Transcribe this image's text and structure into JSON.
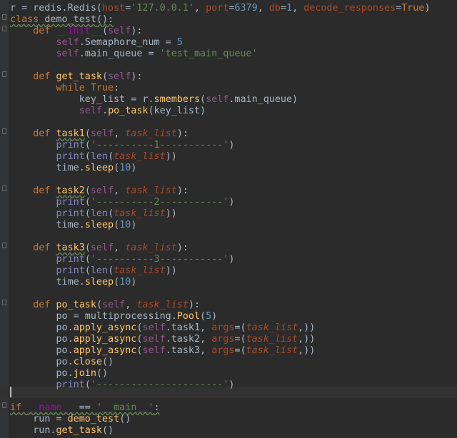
{
  "editor": {
    "lines": [
      [
        {
          "t": "r = redis.Redis(",
          "c": "plain"
        },
        {
          "t": "host",
          "c": "param"
        },
        {
          "t": "=",
          "c": "plain"
        },
        {
          "t": "'127.0.0.1'",
          "c": "str"
        },
        {
          "t": ", ",
          "c": "plain"
        },
        {
          "t": "port",
          "c": "param"
        },
        {
          "t": "=",
          "c": "plain"
        },
        {
          "t": "6379",
          "c": "num"
        },
        {
          "t": ", ",
          "c": "plain"
        },
        {
          "t": "db",
          "c": "param"
        },
        {
          "t": "=",
          "c": "plain"
        },
        {
          "t": "1",
          "c": "num"
        },
        {
          "t": ", ",
          "c": "plain"
        },
        {
          "t": "decode_responses",
          "c": "param"
        },
        {
          "t": "=",
          "c": "plain"
        },
        {
          "t": "True",
          "c": "kw"
        },
        {
          "t": ")",
          "c": "plain"
        }
      ],
      [
        {
          "t": "class ",
          "c": "kw-warn"
        },
        {
          "t": "demo_test",
          "c": "cls-warn"
        },
        {
          "t": "():",
          "c": "plain-warn"
        }
      ],
      [
        {
          "t": "    ",
          "c": "plain"
        },
        {
          "t": "def ",
          "c": "kw"
        },
        {
          "t": "__init__",
          "c": "dunder"
        },
        {
          "t": "(",
          "c": "plain"
        },
        {
          "t": "self",
          "c": "self"
        },
        {
          "t": "):",
          "c": "plain"
        }
      ],
      [
        {
          "t": "        ",
          "c": "plain"
        },
        {
          "t": "self",
          "c": "self"
        },
        {
          "t": ".Semaphore_num = ",
          "c": "plain"
        },
        {
          "t": "5",
          "c": "num"
        }
      ],
      [
        {
          "t": "        ",
          "c": "plain"
        },
        {
          "t": "self",
          "c": "self"
        },
        {
          "t": ".main_queue = ",
          "c": "plain"
        },
        {
          "t": "'test_main_queue'",
          "c": "str"
        }
      ],
      [],
      [
        {
          "t": "    ",
          "c": "plain"
        },
        {
          "t": "def ",
          "c": "kw"
        },
        {
          "t": "get_task",
          "c": "fn"
        },
        {
          "t": "(",
          "c": "plain"
        },
        {
          "t": "self",
          "c": "self"
        },
        {
          "t": "):",
          "c": "plain"
        }
      ],
      [
        {
          "t": "        ",
          "c": "plain"
        },
        {
          "t": "while ",
          "c": "kw"
        },
        {
          "t": "True",
          "c": "kw"
        },
        {
          "t": ":",
          "c": "plain"
        }
      ],
      [
        {
          "t": "            key_list = r.",
          "c": "plain"
        },
        {
          "t": "smembers",
          "c": "call"
        },
        {
          "t": "(",
          "c": "plain"
        },
        {
          "t": "self",
          "c": "self"
        },
        {
          "t": ".main_queue)",
          "c": "plain"
        }
      ],
      [
        {
          "t": "            ",
          "c": "plain"
        },
        {
          "t": "self",
          "c": "self"
        },
        {
          "t": ".",
          "c": "plain"
        },
        {
          "t": "po_task",
          "c": "call"
        },
        {
          "t": "(key_list)",
          "c": "plain"
        }
      ],
      [],
      [
        {
          "t": "    ",
          "c": "plain"
        },
        {
          "t": "def ",
          "c": "kw"
        },
        {
          "t": "task1",
          "c": "fn-warn"
        },
        {
          "t": "(",
          "c": "plain"
        },
        {
          "t": "self",
          "c": "self"
        },
        {
          "t": ", ",
          "c": "plain"
        },
        {
          "t": "task_list",
          "c": "pname"
        },
        {
          "t": "):",
          "c": "plain"
        }
      ],
      [
        {
          "t": "        ",
          "c": "plain"
        },
        {
          "t": "print",
          "c": "builtin"
        },
        {
          "t": "(",
          "c": "plain"
        },
        {
          "t": "'----------1-----------'",
          "c": "str"
        },
        {
          "t": ")",
          "c": "plain"
        }
      ],
      [
        {
          "t": "        ",
          "c": "plain"
        },
        {
          "t": "print",
          "c": "builtin"
        },
        {
          "t": "(",
          "c": "plain"
        },
        {
          "t": "len",
          "c": "builtin"
        },
        {
          "t": "(",
          "c": "plain"
        },
        {
          "t": "task_list",
          "c": "pname"
        },
        {
          "t": "))",
          "c": "plain"
        }
      ],
      [
        {
          "t": "        time.",
          "c": "plain"
        },
        {
          "t": "sleep",
          "c": "call"
        },
        {
          "t": "(",
          "c": "plain"
        },
        {
          "t": "10",
          "c": "num"
        },
        {
          "t": ")",
          "c": "plain"
        }
      ],
      [],
      [
        {
          "t": "    ",
          "c": "plain"
        },
        {
          "t": "def ",
          "c": "kw"
        },
        {
          "t": "task2",
          "c": "fn-warn"
        },
        {
          "t": "(",
          "c": "plain"
        },
        {
          "t": "self",
          "c": "self"
        },
        {
          "t": ", ",
          "c": "plain"
        },
        {
          "t": "task_list",
          "c": "pname"
        },
        {
          "t": "):",
          "c": "plain"
        }
      ],
      [
        {
          "t": "        ",
          "c": "plain"
        },
        {
          "t": "print",
          "c": "builtin"
        },
        {
          "t": "(",
          "c": "plain"
        },
        {
          "t": "'----------2-----------'",
          "c": "str"
        },
        {
          "t": ")",
          "c": "plain"
        }
      ],
      [
        {
          "t": "        ",
          "c": "plain"
        },
        {
          "t": "print",
          "c": "builtin"
        },
        {
          "t": "(",
          "c": "plain"
        },
        {
          "t": "len",
          "c": "builtin"
        },
        {
          "t": "(",
          "c": "plain"
        },
        {
          "t": "task_list",
          "c": "pname"
        },
        {
          "t": "))",
          "c": "plain"
        }
      ],
      [
        {
          "t": "        time.",
          "c": "plain"
        },
        {
          "t": "sleep",
          "c": "call"
        },
        {
          "t": "(",
          "c": "plain"
        },
        {
          "t": "10",
          "c": "num"
        },
        {
          "t": ")",
          "c": "plain"
        }
      ],
      [],
      [
        {
          "t": "    ",
          "c": "plain"
        },
        {
          "t": "def ",
          "c": "kw"
        },
        {
          "t": "task3",
          "c": "fn-warn"
        },
        {
          "t": "(",
          "c": "plain"
        },
        {
          "t": "self",
          "c": "self"
        },
        {
          "t": ", ",
          "c": "plain"
        },
        {
          "t": "task_list",
          "c": "pname"
        },
        {
          "t": "):",
          "c": "plain"
        }
      ],
      [
        {
          "t": "        ",
          "c": "plain"
        },
        {
          "t": "print",
          "c": "builtin"
        },
        {
          "t": "(",
          "c": "plain"
        },
        {
          "t": "'----------3-----------'",
          "c": "str"
        },
        {
          "t": ")",
          "c": "plain"
        }
      ],
      [
        {
          "t": "        ",
          "c": "plain"
        },
        {
          "t": "print",
          "c": "builtin"
        },
        {
          "t": "(",
          "c": "plain"
        },
        {
          "t": "len",
          "c": "builtin"
        },
        {
          "t": "(",
          "c": "plain"
        },
        {
          "t": "task_list",
          "c": "pname"
        },
        {
          "t": "))",
          "c": "plain"
        }
      ],
      [
        {
          "t": "        time.",
          "c": "plain"
        },
        {
          "t": "sleep",
          "c": "call"
        },
        {
          "t": "(",
          "c": "plain"
        },
        {
          "t": "10",
          "c": "num"
        },
        {
          "t": ")",
          "c": "plain"
        }
      ],
      [],
      [
        {
          "t": "    ",
          "c": "plain"
        },
        {
          "t": "def ",
          "c": "kw"
        },
        {
          "t": "po_task",
          "c": "fn"
        },
        {
          "t": "(",
          "c": "plain"
        },
        {
          "t": "self",
          "c": "self"
        },
        {
          "t": ", ",
          "c": "plain"
        },
        {
          "t": "task_list",
          "c": "pname"
        },
        {
          "t": "):",
          "c": "plain"
        }
      ],
      [
        {
          "t": "        po = multiprocessing.",
          "c": "plain"
        },
        {
          "t": "Pool",
          "c": "call"
        },
        {
          "t": "(",
          "c": "plain"
        },
        {
          "t": "5",
          "c": "num"
        },
        {
          "t": ")",
          "c": "plain"
        }
      ],
      [
        {
          "t": "        po.",
          "c": "plain"
        },
        {
          "t": "apply_async",
          "c": "call"
        },
        {
          "t": "(",
          "c": "plain"
        },
        {
          "t": "self",
          "c": "self"
        },
        {
          "t": ".task1, ",
          "c": "plain"
        },
        {
          "t": "args",
          "c": "param"
        },
        {
          "t": "=(",
          "c": "plain"
        },
        {
          "t": "task_list",
          "c": "pname"
        },
        {
          "t": ",))",
          "c": "plain"
        }
      ],
      [
        {
          "t": "        po.",
          "c": "plain"
        },
        {
          "t": "apply_async",
          "c": "call"
        },
        {
          "t": "(",
          "c": "plain"
        },
        {
          "t": "self",
          "c": "self"
        },
        {
          "t": ".task2, ",
          "c": "plain"
        },
        {
          "t": "args",
          "c": "param"
        },
        {
          "t": "=(",
          "c": "plain"
        },
        {
          "t": "task_list",
          "c": "pname"
        },
        {
          "t": ",))",
          "c": "plain"
        }
      ],
      [
        {
          "t": "        po.",
          "c": "plain"
        },
        {
          "t": "apply_async",
          "c": "call"
        },
        {
          "t": "(",
          "c": "plain"
        },
        {
          "t": "self",
          "c": "self"
        },
        {
          "t": ".task3, ",
          "c": "plain"
        },
        {
          "t": "args",
          "c": "param"
        },
        {
          "t": "=(",
          "c": "plain"
        },
        {
          "t": "task_list",
          "c": "pname"
        },
        {
          "t": ",))",
          "c": "plain"
        }
      ],
      [
        {
          "t": "        po.",
          "c": "plain"
        },
        {
          "t": "close",
          "c": "call"
        },
        {
          "t": "()",
          "c": "plain"
        }
      ],
      [
        {
          "t": "        po.",
          "c": "plain"
        },
        {
          "t": "join",
          "c": "call"
        },
        {
          "t": "()",
          "c": "plain"
        }
      ],
      [
        {
          "t": "        ",
          "c": "plain"
        },
        {
          "t": "print",
          "c": "builtin"
        },
        {
          "t": "(",
          "c": "plain"
        },
        {
          "t": "'----------------------'",
          "c": "str"
        },
        {
          "t": ")",
          "c": "plain"
        }
      ],
      [],
      [
        {
          "t": "if ",
          "c": "kw-warn"
        },
        {
          "t": "__name__",
          "c": "dunder-warn"
        },
        {
          "t": " == ",
          "c": "plain-warn"
        },
        {
          "t": "'__main__'",
          "c": "str-warn"
        },
        {
          "t": ":",
          "c": "plain-warn"
        }
      ],
      [
        {
          "t": "    run = ",
          "c": "plain"
        },
        {
          "t": "demo_test",
          "c": "call"
        },
        {
          "t": "()",
          "c": "plain"
        }
      ],
      [
        {
          "t": "    run.",
          "c": "plain"
        },
        {
          "t": "get_task",
          "c": "call"
        },
        {
          "t": "()",
          "c": "plain"
        }
      ]
    ]
  },
  "colors": {
    "background": "#2b2b2b",
    "keyword": "#cc7832",
    "string": "#6a8759",
    "number": "#6897bb",
    "self": "#94558d",
    "function": "#ffc66d"
  }
}
